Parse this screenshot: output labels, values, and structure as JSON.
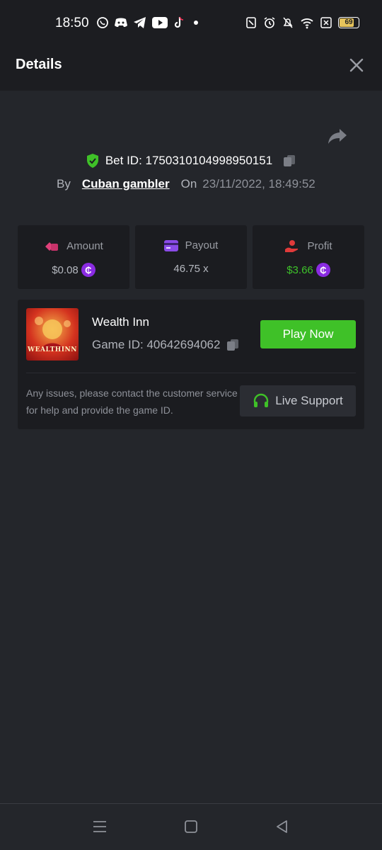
{
  "status_bar": {
    "time": "18:50",
    "battery_level": "69",
    "notification_icons": [
      "whatsapp-icon",
      "discord-icon",
      "telegram-icon",
      "youtube-icon",
      "tiktok-icon",
      "dot-icon"
    ],
    "system_icons": [
      "nfc-icon",
      "alarm-icon",
      "mute-icon",
      "wifi-icon",
      "sim-icon",
      "battery-icon"
    ]
  },
  "header": {
    "title": "Details"
  },
  "bet": {
    "id_label": "Bet ID: 1750310104998950151",
    "by_label": "By",
    "user": "Cuban gambler",
    "on_label": "On",
    "date": "23/11/2022, 18:49:52"
  },
  "stats": {
    "amount": {
      "label": "Amount",
      "value": "$0.08"
    },
    "payout": {
      "label": "Payout",
      "value": "46.75 x"
    },
    "profit": {
      "label": "Profit",
      "value": "$3.66"
    }
  },
  "game": {
    "name": "Wealth Inn",
    "id_label": "Game ID: 40642694062",
    "thumb_text": "WEALTHINN",
    "play_label": "Play Now",
    "help_text": "Any issues, please contact the customer service for help and provide the game ID.",
    "support_label": "Live Support"
  },
  "colors": {
    "accent_green": "#3fc128",
    "coin_purple": "#8a2be2",
    "card_bg": "#1b1c20",
    "page_bg": "#24262b"
  }
}
